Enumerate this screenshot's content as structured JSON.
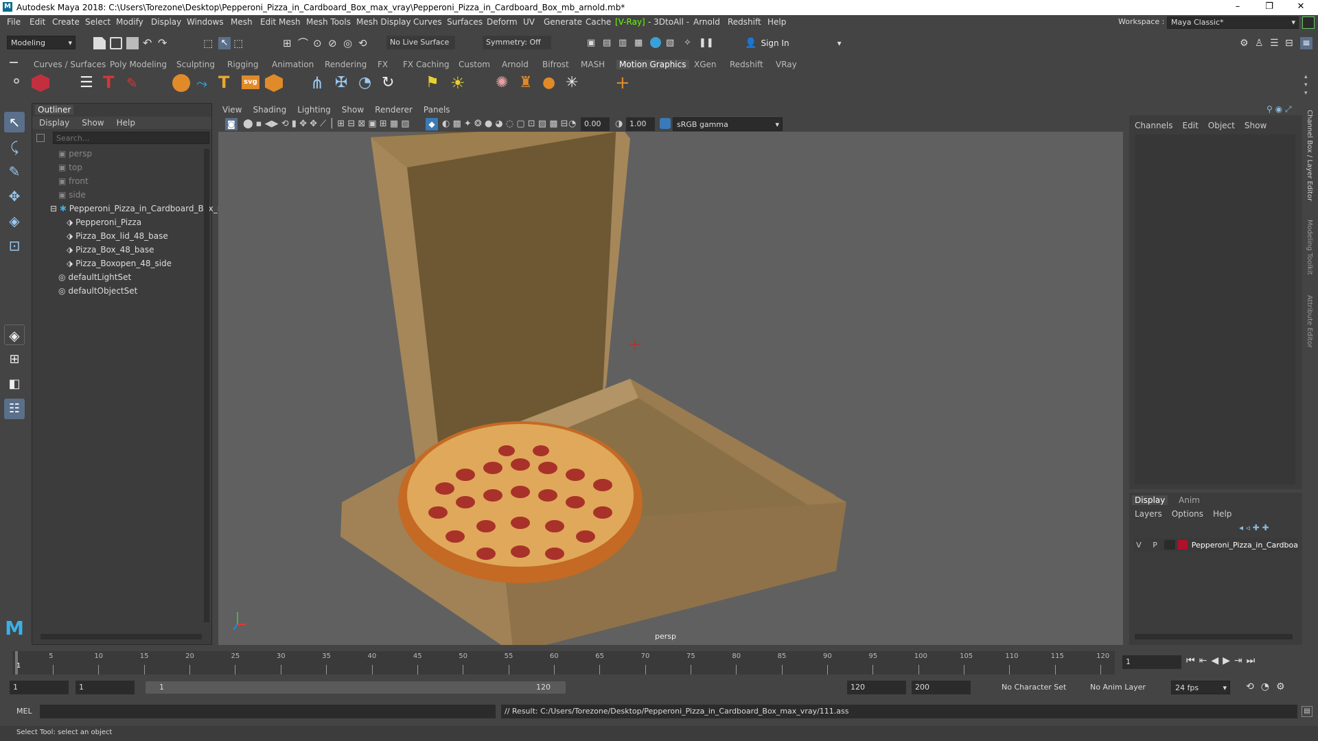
{
  "window": {
    "title": "Autodesk Maya 2018: C:\\Users\\Torezone\\Desktop\\Pepperoni_Pizza_in_Cardboard_Box_max_vray\\Pepperoni_Pizza_in_Cardboard_Box_mb_arnold.mb*",
    "minimize": "–",
    "restore": "❐",
    "close": "✕"
  },
  "menu": [
    "File",
    "Edit",
    "Create",
    "Select",
    "Modify",
    "Display",
    "Windows",
    "Mesh",
    "Edit Mesh",
    "Mesh Tools",
    "Mesh Display",
    "Curves",
    "Surfaces",
    "Deform",
    "UV",
    "Generate",
    "Cache",
    "[V-Ray]",
    "- 3DtoAll -",
    "Arnold",
    "Redshift",
    "Help"
  ],
  "workspace": {
    "label": "Workspace :",
    "value": "Maya Classic*"
  },
  "toolbar": {
    "mode": "Modeling",
    "live_surface": "No Live Surface",
    "symmetry": "Symmetry: Off",
    "sign_in": "Sign In"
  },
  "shelf_tabs": [
    "Curves / Surfaces",
    "Poly Modeling",
    "Sculpting",
    "Rigging",
    "Animation",
    "Rendering",
    "FX",
    "FX Caching",
    "Custom",
    "Arnold",
    "Bifrost",
    "MASH",
    "Motion Graphics",
    "XGen",
    "Redshift",
    "VRay"
  ],
  "shelf_active": "Motion Graphics",
  "outliner": {
    "tab": "Outliner",
    "menu": [
      "Display",
      "Show",
      "Help"
    ],
    "search_placeholder": "Search...",
    "items": [
      {
        "label": "persp",
        "dim": true
      },
      {
        "label": "top",
        "dim": true
      },
      {
        "label": "front",
        "dim": true
      },
      {
        "label": "side",
        "dim": true
      },
      {
        "label": "Pepperoni_Pizza_in_Cardboard_Box_r",
        "dim": false
      },
      {
        "label": "Pepperoni_Pizza",
        "dim": false
      },
      {
        "label": "Pizza_Box_lid_48_base",
        "dim": false
      },
      {
        "label": "Pizza_Box_48_base",
        "dim": false
      },
      {
        "label": "Pizza_Boxopen_48_side",
        "dim": false
      },
      {
        "label": "defaultLightSet",
        "dim": false
      },
      {
        "label": "defaultObjectSet",
        "dim": false
      }
    ]
  },
  "viewport": {
    "menu": [
      "View",
      "Shading",
      "Lighting",
      "Show",
      "Renderer",
      "Panels"
    ],
    "exposure": "0.00",
    "gamma": "1.00",
    "color_space": "sRGB gamma",
    "camera_label": "persp"
  },
  "channel_box": {
    "menu": [
      "Channels",
      "Edit",
      "Object",
      "Show"
    ],
    "side_tabs": [
      "Channel Box / Layer Editor",
      "Modeling Toolkit",
      "Attribute Editor"
    ]
  },
  "layer_editor": {
    "tabs": [
      "Display",
      "Anim"
    ],
    "menu": [
      "Layers",
      "Options",
      "Help"
    ],
    "layer": {
      "v": "V",
      "p": "P",
      "name": "Pepperoni_Pizza_in_Cardboard",
      "color": "#b0102a"
    }
  },
  "timeline": {
    "ticks": [
      "5",
      "10",
      "15",
      "20",
      "25",
      "30",
      "35",
      "40",
      "45",
      "50",
      "55",
      "60",
      "65",
      "70",
      "75",
      "80",
      "85",
      "90",
      "95",
      "100",
      "105",
      "110",
      "115",
      "120"
    ],
    "current_marker": "1",
    "current_frame": "1"
  },
  "range": {
    "start": "1",
    "inner_start": "1",
    "slider_start": "1",
    "slider_end": "120",
    "end": "120",
    "anim_end": "200",
    "character_set": "No Character Set",
    "anim_layer": "No Anim Layer",
    "fps": "24 fps"
  },
  "command": {
    "lang": "MEL",
    "result": "// Result: C:/Users/Torezone/Desktop/Pepperoni_Pizza_in_Cardboard_Box_max_vray/111.ass"
  },
  "help_line": "Select Tool: select an object"
}
